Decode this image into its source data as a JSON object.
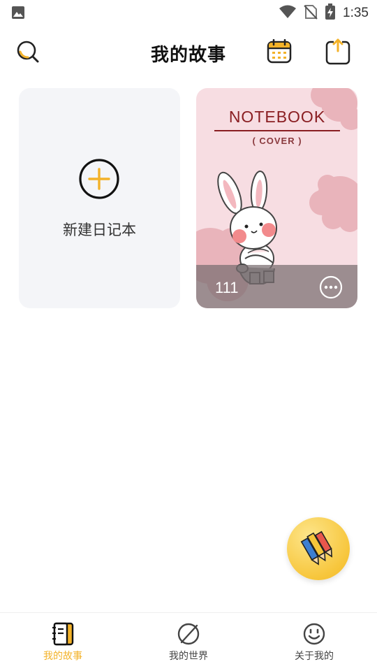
{
  "status_bar": {
    "time": "1:35"
  },
  "header": {
    "title": "我的故事"
  },
  "new_notebook": {
    "label": "新建日记本"
  },
  "notebook": {
    "cover_title": "NOTEBOOK",
    "cover_subtitle": "( COVER )",
    "entry_count": "111"
  },
  "bottom_nav": {
    "items": [
      {
        "label": "我的故事",
        "active": true
      },
      {
        "label": "我的世界",
        "active": false
      },
      {
        "label": "关于我的",
        "active": false
      }
    ]
  },
  "colors": {
    "accent": "#f3b229",
    "cover_pink": "#f7dde2",
    "cover_text": "#8a1e22",
    "card_gray": "#f4f5f8"
  },
  "icons": {
    "header_left": "search-icon",
    "header_right_1": "calendar-icon",
    "header_right_2": "share-export-icon",
    "fab": "pencils-icon"
  }
}
